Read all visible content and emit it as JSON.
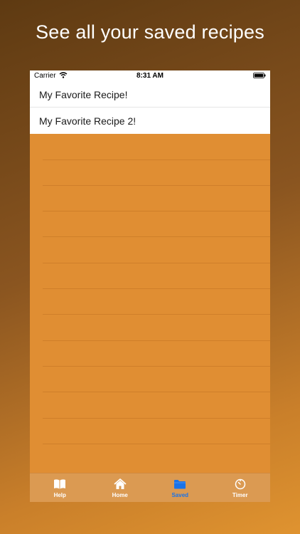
{
  "promo": {
    "title": "See all your saved recipes"
  },
  "status_bar": {
    "carrier": "Carrier",
    "time": "8:31 AM"
  },
  "recipes": [
    {
      "name": "My Favorite Recipe!"
    },
    {
      "name": "My Favorite Recipe 2!"
    }
  ],
  "tabs": [
    {
      "label": "Help",
      "icon": "book-icon",
      "active": false
    },
    {
      "label": "Home",
      "icon": "home-icon",
      "active": false
    },
    {
      "label": "Saved",
      "icon": "folder-icon",
      "active": true
    },
    {
      "label": "Timer",
      "icon": "timer-icon",
      "active": false
    }
  ],
  "colors": {
    "accent": "#1a73e8",
    "list_background": "#e08e33",
    "tabbar_background": "#db9a52"
  }
}
